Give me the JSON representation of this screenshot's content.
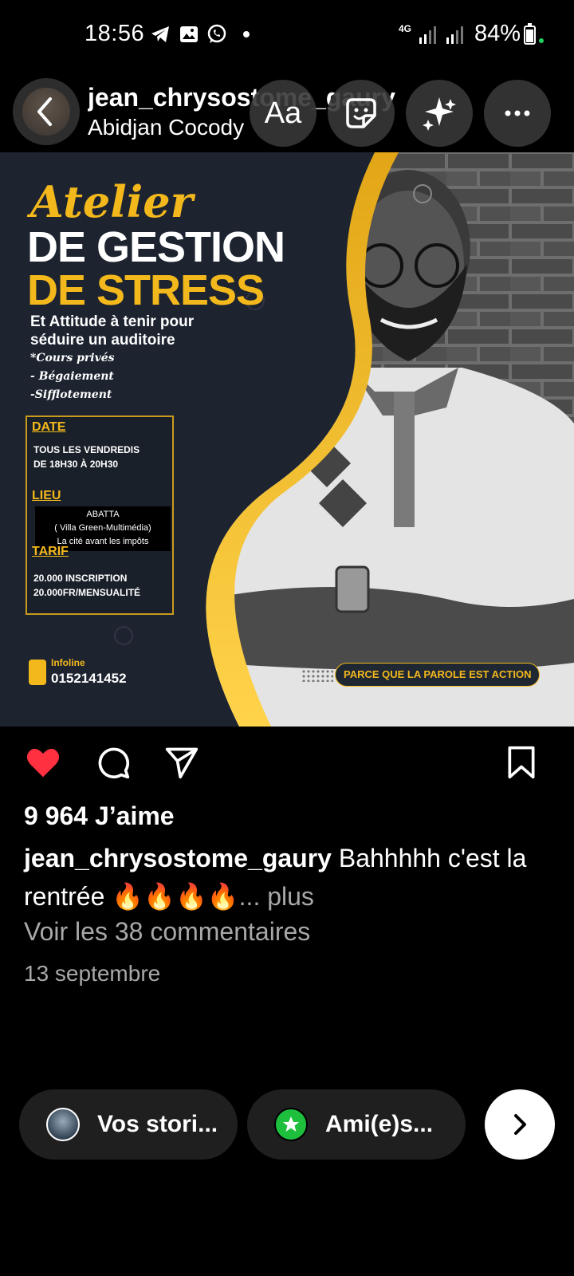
{
  "status_bar": {
    "time": "18:56",
    "network": "4G",
    "battery": "84%",
    "icons": [
      "telegram-icon",
      "gallery-icon",
      "whatsapp-icon",
      "notification-dot",
      "signal-icon",
      "battery-icon"
    ]
  },
  "header": {
    "username": "jean_chrysostome_gaury",
    "location": "Abidjan Cocody",
    "text_button_label": "Aa"
  },
  "poster": {
    "title_line1": "Atelier",
    "title_line2": "DE GESTION",
    "title_line3": "DE STRESS",
    "subtitle_line1": "Et Attitude à tenir pour",
    "subtitle_line2": "séduire un auditoire",
    "bullets": [
      "*Cours privés",
      "- Bégaiement",
      "-Sifflotement"
    ],
    "date_label": "DATE",
    "date_text_1": "TOUS LES VENDREDIS",
    "date_text_2": "DE 18H30 À 20H30",
    "lieu_label": "LIEU",
    "lieu_line1": "ABATTA",
    "lieu_line2": "( Villa Green-Multimédia)",
    "lieu_line3": "La cité avant les impôts",
    "tarif_label": "TARIF",
    "tarif_line1": "20.000 INSCRIPTION",
    "tarif_line2": "20.000FR/MENSUALITÉ",
    "infoline_label": "Infoline",
    "phone": "0152141452",
    "slogan": "PARCE QUE LA PAROLE EST ACTION"
  },
  "post": {
    "likes": "9 964 J’aime",
    "caption_user": "jean_chrysostome_gaury",
    "caption_text": "Bahhhhh c'est la rentrée 🔥🔥🔥🔥",
    "more": "... plus",
    "comments": "Voir les 38 commentaires",
    "date": "13 septembre"
  },
  "share": {
    "your_stories": "Vos stori...",
    "close_friends": "Ami(e)s..."
  },
  "colors": {
    "accent_gold": "#f3b81c",
    "like_red": "#ff3040",
    "close_friends_green": "#1fbf3e"
  }
}
